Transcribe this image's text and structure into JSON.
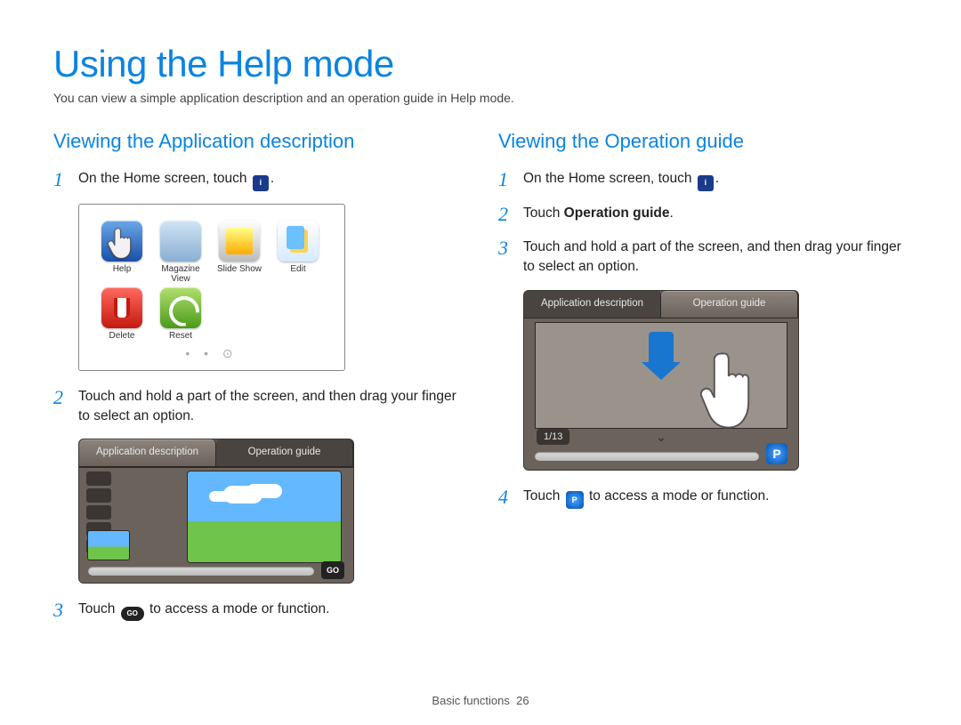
{
  "title": "Using the Help mode",
  "intro": "You can view a simple application description and an operation guide in Help mode.",
  "left": {
    "heading": "Viewing the Application description",
    "steps": {
      "s1": {
        "num": "1",
        "pre": "On the Home screen, touch ",
        "post": "."
      },
      "s2": {
        "num": "2",
        "text": "Touch and hold a part of the screen, and then drag your finger to select an option."
      },
      "s3": {
        "num": "3",
        "pre": "Touch ",
        "post": " to access a mode or function."
      }
    },
    "home_apps": {
      "a0": "Help",
      "a1": "Magazine View",
      "a2": "Slide Show",
      "a3": "Edit",
      "a4": "Delete",
      "a5": "Reset"
    },
    "cam_tabs": {
      "active": "Application description",
      "other": "Operation guide"
    },
    "go_label": "GO"
  },
  "right": {
    "heading": "Viewing the Operation guide",
    "steps": {
      "s1": {
        "num": "1",
        "pre": "On the Home screen, touch ",
        "post": "."
      },
      "s2": {
        "num": "2",
        "pre": "Touch ",
        "bold": "Operation guide",
        "post": "."
      },
      "s3": {
        "num": "3",
        "text": "Touch and hold a part of the screen, and then drag your finger to select an option."
      },
      "s4": {
        "num": "4",
        "pre": "Touch ",
        "post": " to access a mode or function."
      }
    },
    "cam_tabs": {
      "other": "Application description",
      "active": "Operation guide"
    },
    "page_indicator": "1/13",
    "p_label": "P"
  },
  "footer": {
    "section": "Basic functions",
    "page": "26"
  }
}
